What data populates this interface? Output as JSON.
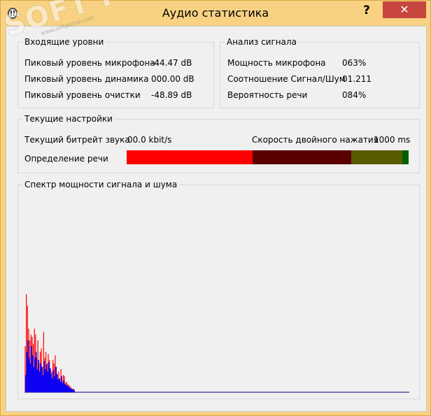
{
  "window": {
    "title": "Аудио статистика",
    "help_label": "?",
    "close_label": "✕"
  },
  "watermark": {
    "main": "SOFT PORTAL",
    "sub": "www.softportal.com"
  },
  "incoming_levels": {
    "legend": "Входящие уровни",
    "rows": [
      {
        "label": "Пиковый уровень микрофона",
        "value": "-44.47 dB"
      },
      {
        "label": "Пиковый уровень динамика",
        "value": "000.00 dB"
      },
      {
        "label": "Пиковый уровень очистки",
        "value": "-48.89 dB"
      }
    ]
  },
  "signal_analysis": {
    "legend": "Анализ сигнала",
    "rows": [
      {
        "label": "Мощность микрофона",
        "value": "063%"
      },
      {
        "label": "Соотношение Сигнал/Шум",
        "value": "01.211"
      },
      {
        "label": "Вероятность речи",
        "value": "084%"
      }
    ]
  },
  "current_settings": {
    "legend": "Текущие настройки",
    "bitrate_label": "Текущий битрейт звука",
    "bitrate_value": "00.0 kbit/s",
    "double_click_label": "Скорость двойного нажатия",
    "double_click_value": "1000 ms",
    "speech_detection_label": "Определение речи",
    "speech_bar_segments": [
      {
        "fraction": 0.447,
        "color": "#ff0000"
      },
      {
        "fraction": 0.35,
        "color": "#5a0000"
      },
      {
        "fraction": 0.18,
        "color": "#5a5a00"
      },
      {
        "fraction": 0.023,
        "color": "#006000"
      }
    ]
  },
  "spectrum": {
    "legend": "Спектр мощности сигнала и шума",
    "signal_color": "#0000ff",
    "noise_color": "#ff0000",
    "signal_values": [
      0.15,
      0.35,
      0.45,
      0.3,
      0.25,
      0.4,
      0.32,
      0.22,
      0.3,
      0.35,
      0.2,
      0.28,
      0.18,
      0.25,
      0.22,
      0.15,
      0.27,
      0.2,
      0.24,
      0.18,
      0.26,
      0.21,
      0.16,
      0.12,
      0.19,
      0.14,
      0.22,
      0.16,
      0.11,
      0.12,
      0.09,
      0.14,
      0.08,
      0.1,
      0.07,
      0.06,
      0.06,
      0.05,
      0.04,
      0.03,
      0.03,
      0.02,
      0.02
    ],
    "noise_values": [
      0.4,
      0.85,
      0.75,
      0.55,
      0.45,
      0.5,
      0.48,
      0.42,
      0.55,
      0.5,
      0.3,
      0.45,
      0.25,
      0.35,
      0.38,
      0.22,
      0.52,
      0.3,
      0.35,
      0.25,
      0.33,
      0.28,
      0.2,
      0.18,
      0.28,
      0.25,
      0.32,
      0.22,
      0.15,
      0.18,
      0.12,
      0.2,
      0.1,
      0.15,
      0.14,
      0.08,
      0.09,
      0.07,
      0.06,
      0.05,
      0.04,
      0.03,
      0.03
    ],
    "baseline_color": "#000080"
  }
}
